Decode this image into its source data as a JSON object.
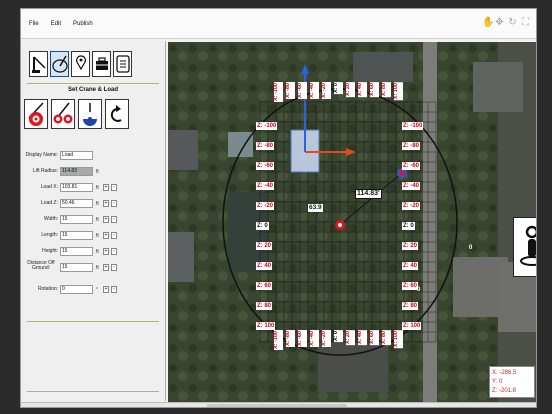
{
  "menu": {
    "file": "File",
    "edit": "Edit",
    "publish": "Publish"
  },
  "sidebar": {
    "section_title": "Set Crane & Load",
    "fields": [
      {
        "label": "Display Name:",
        "value": "Load",
        "unit": "",
        "readonly": false,
        "stepper": false
      },
      {
        "label": "Lift Radius:",
        "value": "114.83",
        "unit": "ft",
        "readonly": true,
        "stepper": false
      },
      {
        "label": "Load X:",
        "value": "103.81",
        "unit": "ft",
        "readonly": false,
        "stepper": true
      },
      {
        "label": "Load Z:",
        "value": "50.46",
        "unit": "ft",
        "readonly": false,
        "stepper": true
      },
      {
        "label": "Width:",
        "value": "15",
        "unit": "ft",
        "readonly": false,
        "stepper": true
      },
      {
        "label": "Length:",
        "value": "15",
        "unit": "ft",
        "readonly": false,
        "stepper": true
      },
      {
        "label": "Height:",
        "value": "15",
        "unit": "ft",
        "readonly": false,
        "stepper": true
      },
      {
        "label": "Distance Off Ground:",
        "value": "15",
        "unit": "ft",
        "readonly": false,
        "stepper": true
      },
      {
        "label": "Rotation:",
        "value": "0",
        "unit": "°",
        "readonly": false,
        "stepper": true
      }
    ],
    "plus": "+",
    "minus": "-"
  },
  "map": {
    "radius_label": "114.83'",
    "height_label": "63.9",
    "zero_label_a": "0",
    "zero_label_b": "0",
    "z_left": [
      "Z: -100",
      "Z: -80",
      "Z: -60",
      "Z: -40",
      "Z: -20",
      "Z: 0",
      "Z: 20",
      "Z: 40",
      "Z: 60",
      "Z: 80",
      "Z: 100"
    ],
    "z_right": [
      "Z: -100",
      "Z: -80",
      "Z: -60",
      "Z: -40",
      "Z: -20",
      "Z: 0",
      "Z: 20",
      "Z: 40",
      "Z: 60",
      "Z: 80",
      "Z: 100"
    ],
    "x_top": [
      "X: -100",
      "X: -80",
      "X: -60",
      "X: -40",
      "X: -20",
      "X: 0",
      "X: 20",
      "X: 40",
      "X: 60",
      "X: 80",
      "X: 100"
    ],
    "x_bottom": [
      "X: -100",
      "X: -80",
      "X: -60",
      "X: -40",
      "X: -20",
      "X: 0",
      "X: 20",
      "X: 40",
      "X: 60",
      "X: 80",
      "X: 100"
    ],
    "coords": {
      "x": "X: -286.5",
      "y": "Y: 0",
      "z": "Z: -201.8"
    }
  },
  "colors": {
    "label_red": "#d0021b",
    "crane_blue": "#3555c9",
    "accent_green": "#9dc06d"
  }
}
